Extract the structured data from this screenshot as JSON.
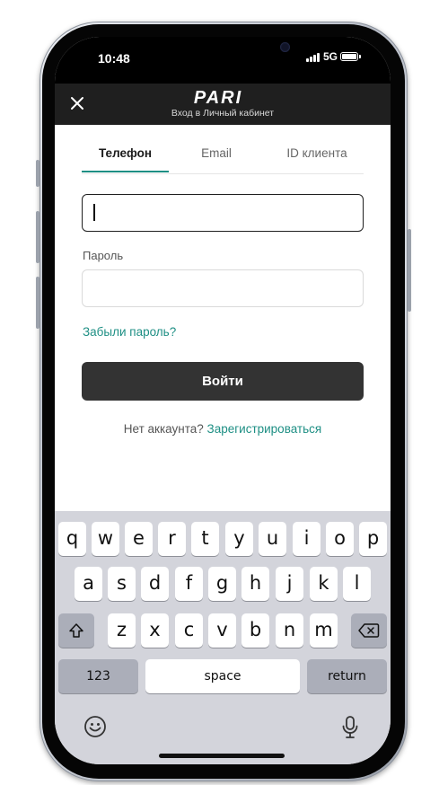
{
  "status_bar": {
    "time": "10:48",
    "network": "5G"
  },
  "header": {
    "subtitle": "Вход в Личный кабинет",
    "brand": "PARI"
  },
  "tabs": [
    {
      "label": "Телефон",
      "active": true
    },
    {
      "label": "Email",
      "active": false
    },
    {
      "label": "ID клиента",
      "active": false
    }
  ],
  "form": {
    "phone_value": "",
    "password_label": "Пароль",
    "password_value": "",
    "forgot_password": "Забыли пароль?",
    "login_button": "Войти",
    "no_account": "Нет аккаунта?",
    "register": "Зарегистрироваться"
  },
  "keyboard": {
    "row1": [
      "q",
      "w",
      "e",
      "r",
      "t",
      "y",
      "u",
      "i",
      "o",
      "p"
    ],
    "row2": [
      "a",
      "s",
      "d",
      "f",
      "g",
      "h",
      "j",
      "k",
      "l"
    ],
    "row3": [
      "z",
      "x",
      "c",
      "v",
      "b",
      "n",
      "m"
    ],
    "numbers_key": "123",
    "space_key": "space",
    "return_key": "return"
  },
  "colors": {
    "accent": "#1e8f84",
    "header_bg": "#1f1f1f",
    "button_bg": "#333333",
    "keyboard_bg": "#d3d4db"
  },
  "icons": {
    "close": "close-icon",
    "shift": "shift-icon",
    "backspace": "backspace-icon",
    "emoji": "emoji-icon",
    "microphone": "microphone-icon"
  }
}
